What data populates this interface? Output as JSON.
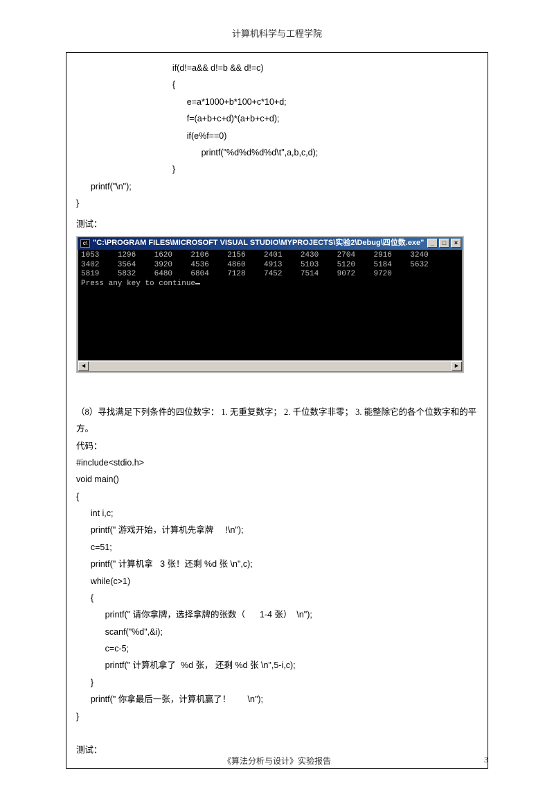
{
  "header": "计算机科学与工程学院",
  "code1": {
    "l1": "                                        if(d!=a&& d!=b && d!=c)",
    "l2": "                                        {",
    "l3": "                                              e=a*1000+b*100+c*10+d;",
    "l4": "                                              f=(a+b+c+d)*(a+b+c+d);",
    "l5": "                                              if(e%f==0)",
    "l6": "                                                    printf(\"%d%d%d%d\\t\",a,b,c,d);",
    "l7": "                                        }",
    "l8": "      printf(\"\\n\");",
    "l9": "}"
  },
  "test_label": "测试：",
  "console": {
    "title": "\"C:\\PROGRAM FILES\\MICROSOFT VISUAL STUDIO\\MYPROJECTS\\实验2\\Debug\\四位数.exe\"",
    "rows": [
      "1053    1296    1620    2106    2156    2401    2430    2704    2916    3240",
      "3402    3564    3920    4536    4860    4913    5103    5120    5184    5632",
      "5819    5832    6480    6804    7128    7452    7514    9072    9720"
    ],
    "continue": "Press any key to continue"
  },
  "problem8": "（8）寻找满足下列条件的四位数字：  1. 无重复数字；  2. 千位数字非零；  3. 能整除它的各个位数字和的平方。",
  "code_label": "代码：",
  "code2": {
    "l1": "#include<stdio.h>",
    "l2": "void main()",
    "l3": "{",
    "l4": "      int i,c;",
    "l5_a": "      printf(\" 游戏开始，计算机先拿牌",
    "l5_b": "     !\\n\");",
    "l6": "      c=51;",
    "l7_a": "      printf(\" 计算机拿",
    "l7_b": "   3 张！还剩 %d 张 \\n\",c);",
    "l8": "      while(c>1)",
    "l9": "      {",
    "l10_a": "            printf(\" 请你拿牌，选择拿牌的张数（",
    "l10_b": "      1-4 张）  \\n\");",
    "l11": "            scanf(\"%d\",&i);",
    "l12": "            c=c-5;",
    "l13_a": "            printf(\" 计算机拿了",
    "l13_b": "  %d 张， 还剩 %d 张 \\n\",5-i,c);",
    "l14": "      }",
    "l15_a": "      printf(\" 你拿最后一张，计算机赢了！",
    "l15_b": "       \\n\");",
    "l16": "}"
  },
  "test_label2": "测试：",
  "footer": {
    "center": "《算法分析与设计》实验报告",
    "page": "3"
  }
}
